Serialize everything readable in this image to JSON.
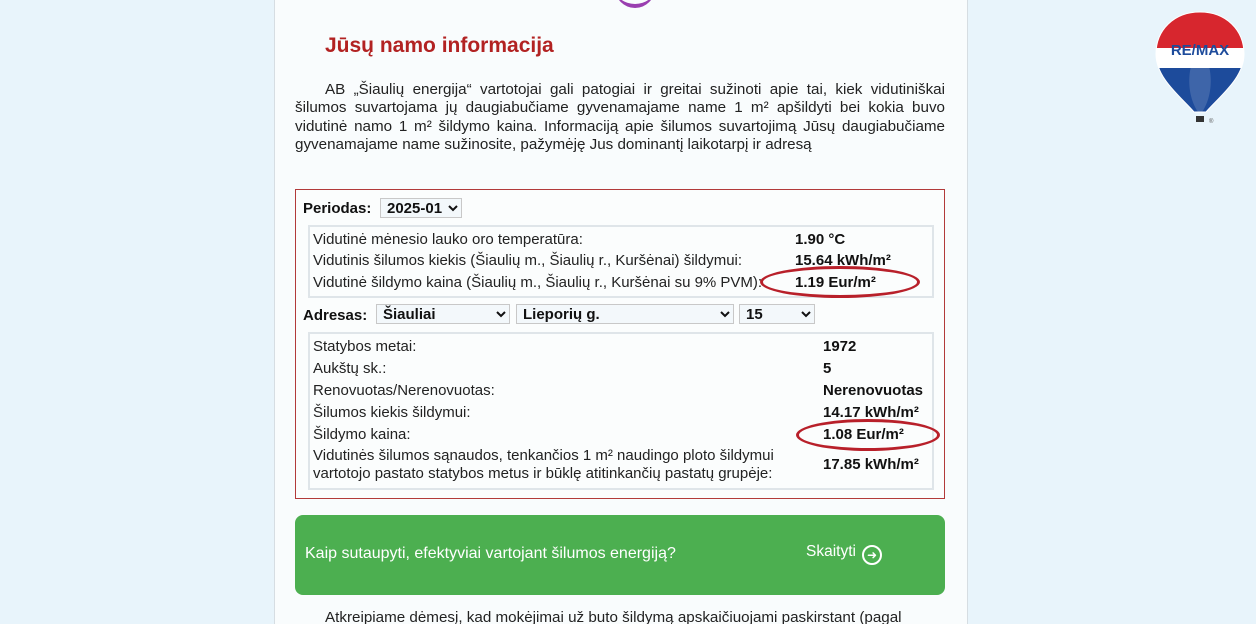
{
  "page": {
    "title": "Jūsų namo informacija",
    "intro": "AB „Šiaulių energija“ vartotojai gali patogiai ir greitai sužinoti apie tai, kiek vidutiniškai šilumos suvartojama jų daugiabučiame gyvenamajame name 1 m² apšildyti bei kokia buvo vidutinė namo 1 m² šildymo kaina. Informaciją apie šilumos suvartojimą Jūsų daugiabučiame gyvenamajame name sužinosite, pažymėję Jus dominantį laikotarpį ir adresą"
  },
  "period": {
    "label": "Periodas:",
    "selected": "2025-01"
  },
  "averages": [
    {
      "label": "Vidutinė mėnesio lauko oro temperatūra:",
      "value": "1.90 °C"
    },
    {
      "label": "Vidutinis šilumos kiekis (Šiaulių m., Šiaulių r., Kuršėnai) šildymui:",
      "value": "15.64 kWh/m²"
    },
    {
      "label": "Vidutinė šildymo kaina (Šiaulių m., Šiaulių r., Kuršėnai su 9% PVM):",
      "value": "1.19 Eur/m²"
    }
  ],
  "address": {
    "label": "Adresas:",
    "city": "Šiauliai",
    "street": "Lieporių g.",
    "number": "15"
  },
  "building": [
    {
      "label": "Statybos metai:",
      "value": "1972"
    },
    {
      "label": "Aukštų sk.:",
      "value": "5"
    },
    {
      "label": "Renovuotas/Nerenovuotas:",
      "value": "Nerenovuotas"
    },
    {
      "label": "Šilumos kiekis šildymui:",
      "value": "14.17 kWh/m²"
    },
    {
      "label": "Šildymo kaina:",
      "value": "1.08 Eur/m²"
    },
    {
      "label_line1": "Vidutinės šilumos sąnaudos, tenkančios 1 m² naudingo ploto šildymui",
      "label_line2": "vartotojo pastato statybos metus ir būklę atitinkančių pastatų grupėje:",
      "value": "17.85 kWh/m²"
    }
  ],
  "banner": {
    "text": "Kaip sutaupyti, efektyviai vartojant šilumos energiją?",
    "link": "Skaityti",
    "color": "#4caf50"
  },
  "bottom_text": "Atkreipiame dėmesį, kad mokėjimai už buto šildymą apskaičiuojami paskirstant (pagal",
  "logo": {
    "text": "RE/MAX",
    "trademark": "®"
  },
  "colors": {
    "title": "#b22222",
    "highlight_oval": "#b8202a",
    "box_border": "#b23a3a"
  }
}
